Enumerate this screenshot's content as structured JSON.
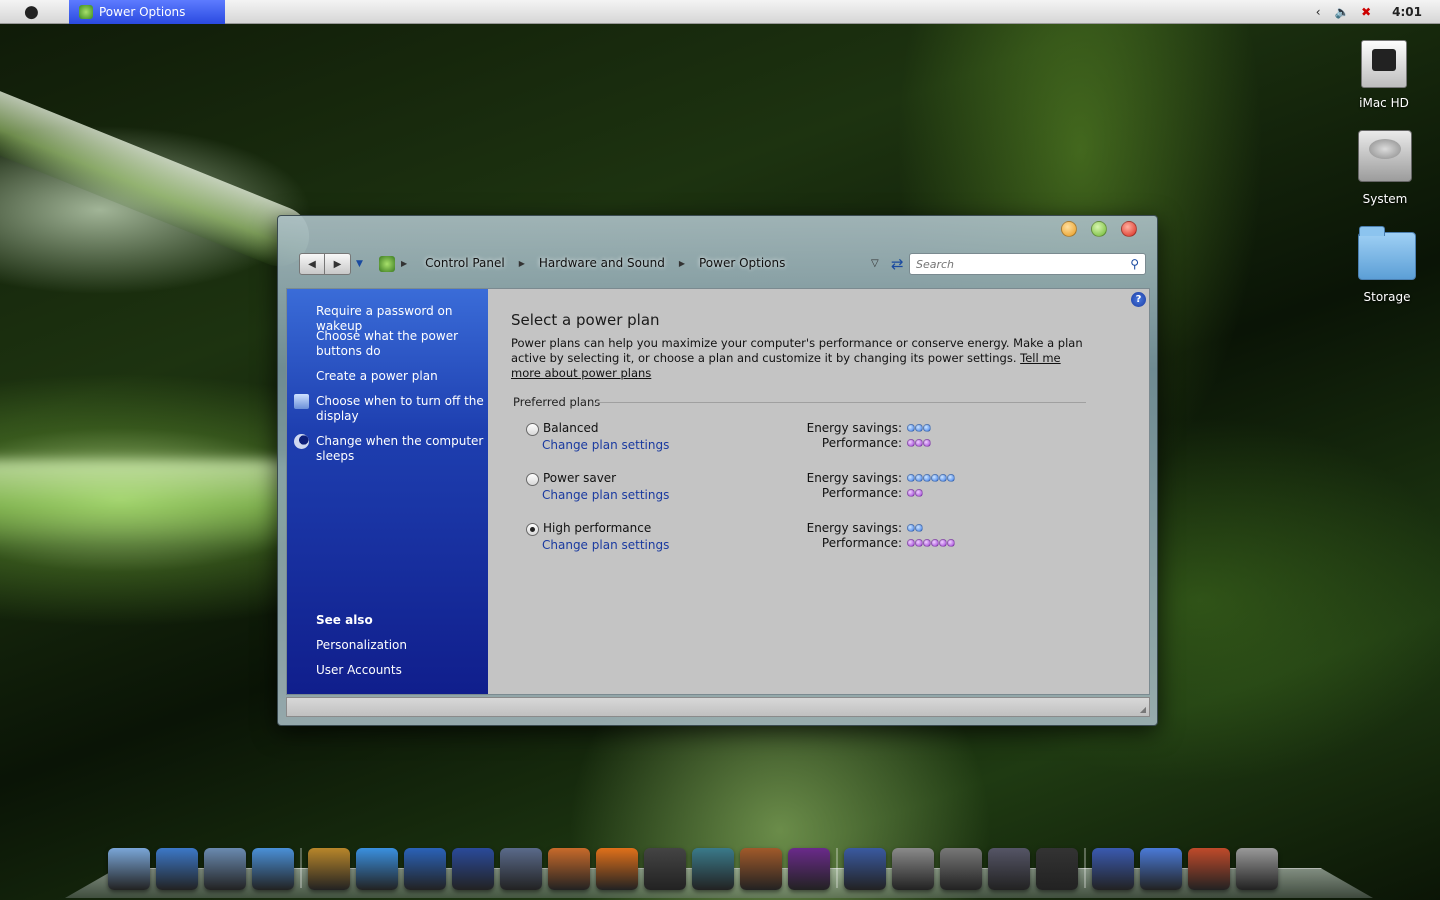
{
  "menubar": {
    "apple_glyph": "",
    "task_button": "Power Options",
    "clock": "4:01",
    "tray_icons": [
      "chevron-left-icon",
      "speaker-icon",
      "network-warning-icon"
    ]
  },
  "desktop": {
    "icons": [
      {
        "label": "iMac  HD",
        "icon": "hard-drive-icon"
      },
      {
        "label": "System",
        "icon": "system-disk-icon"
      },
      {
        "label": "Storage",
        "icon": "folder-icon"
      }
    ]
  },
  "window": {
    "breadcrumb": [
      "Control Panel",
      "Hardware and Sound",
      "Power Options"
    ],
    "search_placeholder": "Search",
    "sidebar": {
      "links": [
        "Require a password on wakeup",
        "Choose what the power buttons do",
        "Create a power plan",
        "Choose when to turn off the display",
        "Change when the computer sleeps"
      ],
      "see_also_heading": "See also",
      "see_also_links": [
        "Personalization",
        "User Accounts"
      ]
    },
    "content": {
      "title": "Select a power plan",
      "description": "Power plans can help you maximize your computer's performance or conserve energy. Make a plan active by selecting it, or choose a plan and customize it by changing its power settings.",
      "description_link": "Tell me more about power plans",
      "preferred_label": "Preferred plans",
      "energy_label": "Energy savings:",
      "performance_label": "Performance:",
      "plans": [
        {
          "name": "Balanced",
          "link": "Change plan settings",
          "selected": false,
          "energy_savings": 3,
          "performance": 3
        },
        {
          "name": "Power saver",
          "link": "Change plan settings",
          "selected": false,
          "energy_savings": 6,
          "performance": 2
        },
        {
          "name": "High performance",
          "link": "Change plan settings",
          "selected": true,
          "energy_savings": 2,
          "performance": 6
        }
      ]
    }
  },
  "colors": {
    "sidebar_top": "#3a6cd8",
    "sidebar_bottom": "#101e8c",
    "link_blue": "#1a3aa0",
    "energy_dot": "#3a7ae8",
    "performance_dot": "#a040d8"
  },
  "dock": {
    "items": [
      "finder-icon",
      "dashboard-icon",
      "mail-icon",
      "safari-icon",
      "address-book-icon",
      "ichat-icon",
      "dvd-player-icon",
      "imovie-icon",
      "iphoto-icon",
      "photo-booth-icon",
      "firefox-icon",
      "activity-monitor-icon",
      "time-machine-icon",
      "home-icon",
      "front-row-icon",
      "utilities-icon",
      "scissors-icon",
      "system-preferences-icon",
      "network-icon",
      "power-icon",
      "movies-folder-icon",
      "music-folder-icon",
      "documents-folder-icon",
      "trash-icon"
    ]
  }
}
